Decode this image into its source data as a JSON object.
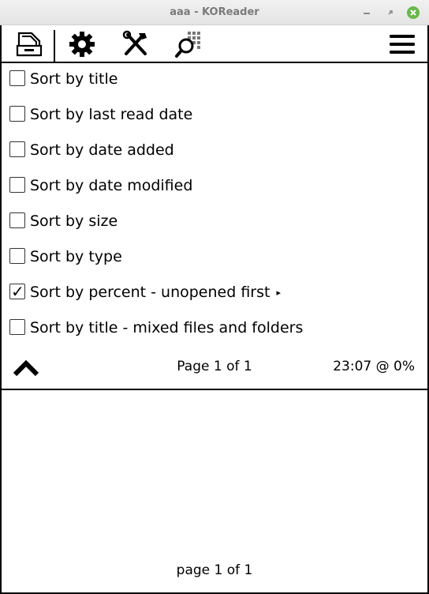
{
  "window": {
    "title": "aaa - KOReader",
    "close_color": "#6ab84a"
  },
  "tabs": [
    {
      "name": "filemanager-icon",
      "selected": true
    },
    {
      "name": "settings-icon",
      "selected": false
    },
    {
      "name": "tools-icon",
      "selected": false
    },
    {
      "name": "search-icon",
      "selected": false
    },
    {
      "name": "hamburger-menu-icon",
      "selected": false
    }
  ],
  "menu": {
    "items": [
      {
        "label": "Sort by title",
        "checked": false,
        "has_submenu": false
      },
      {
        "label": "Sort by last read date",
        "checked": false,
        "has_submenu": false
      },
      {
        "label": "Sort by date added",
        "checked": false,
        "has_submenu": false
      },
      {
        "label": "Sort by date modified",
        "checked": false,
        "has_submenu": false
      },
      {
        "label": "Sort by size",
        "checked": false,
        "has_submenu": false
      },
      {
        "label": "Sort by type",
        "checked": false,
        "has_submenu": false
      },
      {
        "label": "Sort by percent - unopened first",
        "checked": true,
        "has_submenu": true
      },
      {
        "label": "Sort by title - mixed files and folders",
        "checked": false,
        "has_submenu": false
      }
    ],
    "check_glyph": "✓",
    "submenu_glyph": "▸"
  },
  "footer": {
    "page_info": "Page 1 of 1",
    "status": "23:07 @ 0%"
  },
  "bottom": {
    "page_info": "page 1 of 1"
  }
}
